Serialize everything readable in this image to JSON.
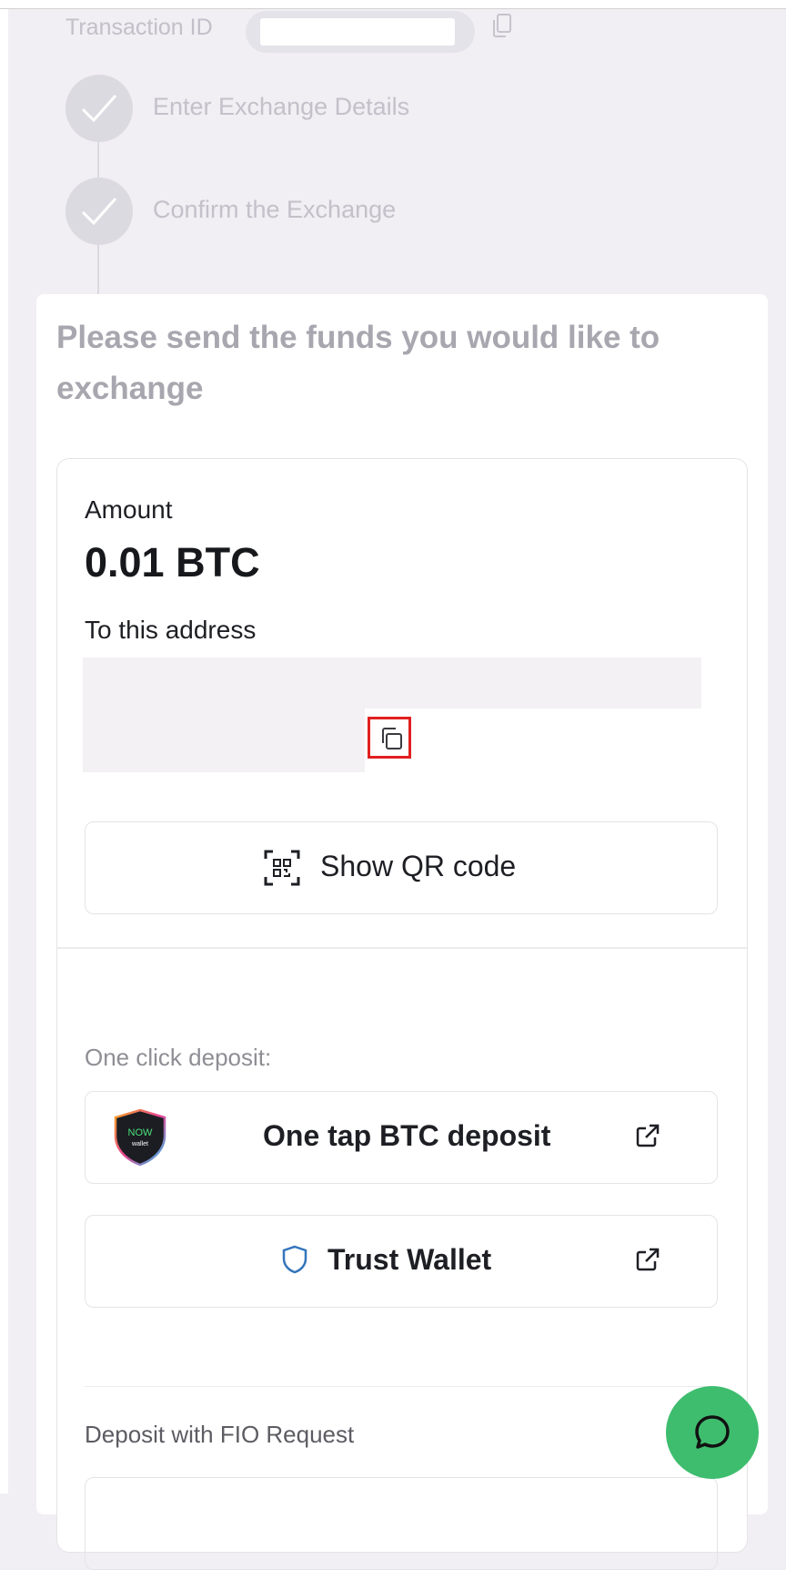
{
  "header": {
    "transaction_id_label": "Transaction ID"
  },
  "steps": [
    {
      "label": "Enter Exchange Details",
      "status": "done"
    },
    {
      "label": "Confirm the Exchange",
      "status": "done"
    }
  ],
  "send": {
    "title": "Please send the funds you would like to exchange",
    "amount_label": "Amount",
    "amount_value": "0.01 BTC",
    "address_label": "To this address",
    "show_qr_label": "Show QR code"
  },
  "one_click": {
    "label": "One click deposit:",
    "options": [
      {
        "label": "One tap BTC deposit",
        "icon": "now-wallet-logo",
        "logo_text": "NOW wallet"
      },
      {
        "label": "Trust Wallet",
        "icon": "shield-icon"
      }
    ]
  },
  "fio": {
    "label": "Deposit with FIO Request"
  },
  "colors": {
    "background": "#f1eef4",
    "accent_green": "#3fbd6f",
    "highlight_red": "#e0201f"
  }
}
